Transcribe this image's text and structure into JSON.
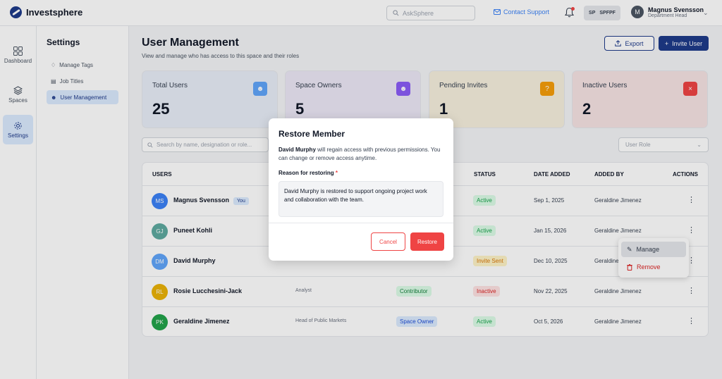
{
  "app": {
    "name": "Investsphere"
  },
  "topbar": {
    "search_placeholder": "AskSphere",
    "contact_label": "Contact Support",
    "space_code": "SP",
    "space_name": "SPFPF",
    "user_initial": "M",
    "user_name": "Magnus Svensson",
    "user_role": "Department Head"
  },
  "rail": [
    {
      "label": "Dashboard",
      "icon": "grid-icon"
    },
    {
      "label": "Spaces",
      "icon": "layers-icon"
    },
    {
      "label": "Settings",
      "icon": "gear-icon"
    }
  ],
  "settings": {
    "title": "Settings",
    "items": [
      "Manage Tags",
      "Job Titles",
      "User Management"
    ]
  },
  "page": {
    "title": "User Management",
    "subtitle": "View and manage  who has access to this space and their roles",
    "export_label": "Export",
    "invite_label": "Invite User"
  },
  "cards": [
    {
      "label": "Total Users",
      "value": "25",
      "color": "#60a5fa"
    },
    {
      "label": "Space Owners",
      "value": "5",
      "color": "#8b5cf6"
    },
    {
      "label": "Pending Invites",
      "value": "1",
      "color": "#f59e0b"
    },
    {
      "label": "Inactive Users",
      "value": "2",
      "color": "#ef4444"
    }
  ],
  "filters": {
    "search_placeholder": "Search by name, designation or role...",
    "role_placeholder": "User Role"
  },
  "table": {
    "headers": [
      "USERS",
      "STATUS",
      "DATE ADDED",
      "ADDED BY",
      "ACTIONS"
    ],
    "rows": [
      {
        "initials": "MS",
        "name": "Magnus Svensson",
        "you": "You",
        "title": "",
        "role": "",
        "status": "Active",
        "date": "Sep 1, 2025",
        "added_by": "Geraldine Jimenez"
      },
      {
        "initials": "GJ",
        "name": "Puneet Kohli",
        "you": "",
        "title": "",
        "role": "",
        "status": "Active",
        "date": "Jan 15, 2026",
        "added_by": "Geraldine Jimenez"
      },
      {
        "initials": "DM",
        "name": "David Murphy",
        "you": "",
        "title": "",
        "role": "",
        "status": "Invite Sent",
        "date": "Dec 10, 2025",
        "added_by": "Geraldine Jimenez"
      },
      {
        "initials": "RL",
        "name": "Rosie Lucchesini-Jack",
        "you": "",
        "title": "Analyst",
        "role": "Contributor",
        "status": "Inactive",
        "date": "Nov 22, 2025",
        "added_by": "Geraldine Jimenez"
      },
      {
        "initials": "PK",
        "name": "Geraldine Jimenez",
        "you": "",
        "title": "Head of Public Markets",
        "role": "Space Owner",
        "status": "Active",
        "date": "Oct 5, 2026",
        "added_by": "Geraldine Jimenez"
      }
    ]
  },
  "menu": {
    "manage": "Manage",
    "remove": "Remove"
  },
  "modal": {
    "title": "Restore Member",
    "desc_name": "David Murphy",
    "desc_rest": " will regain access with previous permissions. You can change or remove access anytime.",
    "label": "Reason for restoring",
    "required": "*",
    "reason": "David Murphy is restored to support ongoing project work and collaboration with the team.",
    "cancel": "Cancel",
    "restore": "Restore"
  }
}
